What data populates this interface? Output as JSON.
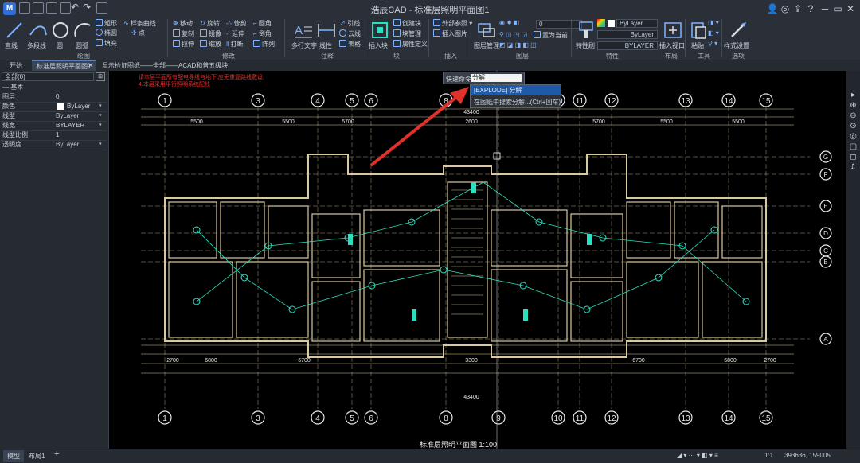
{
  "title_bar": {
    "title": "浩辰CAD - 标准层照明平面图1"
  },
  "ribbon": {
    "draw": {
      "group_label": "绘图",
      "line": "直线",
      "polyline": "多段线",
      "circle": "圆",
      "arc": "圆弧",
      "rectangle": "矩形",
      "ellipse": "椭圆",
      "hatch": "填充",
      "spline": "样条曲线",
      "point": "点"
    },
    "modify": {
      "group_label": "修改",
      "move": "移动",
      "rotate": "旋转",
      "trim": "修剪",
      "fillet": "圆角",
      "copy": "复制",
      "mirror": "镜像",
      "extend": "延伸",
      "chamfer": "倒角",
      "stretch": "拉伸",
      "scale": "缩放",
      "break": "打断",
      "array": "阵列"
    },
    "annotation": {
      "group_label": "注释",
      "mtext": "多行文字",
      "linear": "线性",
      "leader": "引线",
      "revcloud": "云线",
      "table": "表格"
    },
    "block": {
      "group_label": "块",
      "insert": "插入块",
      "create": "创建块",
      "manager": "块管理",
      "attdef": "属性定义"
    },
    "insert": {
      "group_label": "插入",
      "xref": "外部参照",
      "image": "插入图片"
    },
    "layers": {
      "group_label": "图层",
      "manager": "图层管理",
      "current_layer": "0",
      "set_current": "置为当前"
    },
    "properties": {
      "group_label": "特性",
      "match": "特性刷",
      "color": "ByLayer",
      "linetype": "ByLayer",
      "lineweight": "BYLAYER"
    },
    "layout": {
      "group_label": "布局",
      "viewport": "插入视口"
    },
    "tools": {
      "group_label": "工具",
      "paste": "粘贴"
    },
    "options": {
      "group_label": "选项",
      "style": "样式设置"
    }
  },
  "tabs": [
    {
      "label": "开始"
    },
    {
      "label": "标准层照明平面图1"
    },
    {
      "label": "显示检证图纸——全部——ACAD和普五级块"
    }
  ],
  "panel": {
    "selection": "全部(0)",
    "section": "基本",
    "rows": [
      {
        "key": "图层",
        "value": "0"
      },
      {
        "key": "颜色",
        "value": "ByLayer"
      },
      {
        "key": "线型",
        "value": "ByLayer"
      },
      {
        "key": "线宽",
        "value": "BYLAYER"
      },
      {
        "key": "线型比例",
        "value": "1"
      },
      {
        "key": "透明度",
        "value": "ByLayer"
      }
    ]
  },
  "quick_input": {
    "label": "快速命令",
    "value": "分解"
  },
  "suggestions": [
    {
      "text": "[EXPLODE] 分解"
    },
    {
      "text": "在图纸中搜索分解...(Ctrl+回车)"
    }
  ],
  "drawing": {
    "notes": [
      "请本层平面所有配电导线与地下,应无重复路线敷设,",
      "4.本层采用平行照明系统配线"
    ],
    "plan_title": "标准层照明平面图 1:100",
    "grid_numbers": [
      "1",
      "3",
      "4",
      "5",
      "6",
      "8",
      "9",
      "10",
      "11",
      "12",
      "13",
      "14",
      "15"
    ],
    "grid_letters_right": [
      "G",
      "F",
      "E",
      "D",
      "C",
      "B",
      "A"
    ],
    "dim_total": "43400",
    "dims_top": [
      "5500",
      "5500",
      "5700",
      "2600",
      "5700",
      "5500",
      "5500"
    ],
    "dims_bottom": [
      "2700",
      "6800",
      "6700",
      "3300",
      "6700",
      "6800",
      "2700"
    ]
  },
  "status": {
    "model_tab": "模型",
    "layout_tab": "布局1",
    "scale": "1:1",
    "coords": "393636, 159005"
  },
  "colors": {
    "accent": "#2f6fd6",
    "canvas_bg": "#000000",
    "plan_lines": "#d8c9a0",
    "arrow": "#e0312b",
    "wire": "#2be0c0"
  }
}
